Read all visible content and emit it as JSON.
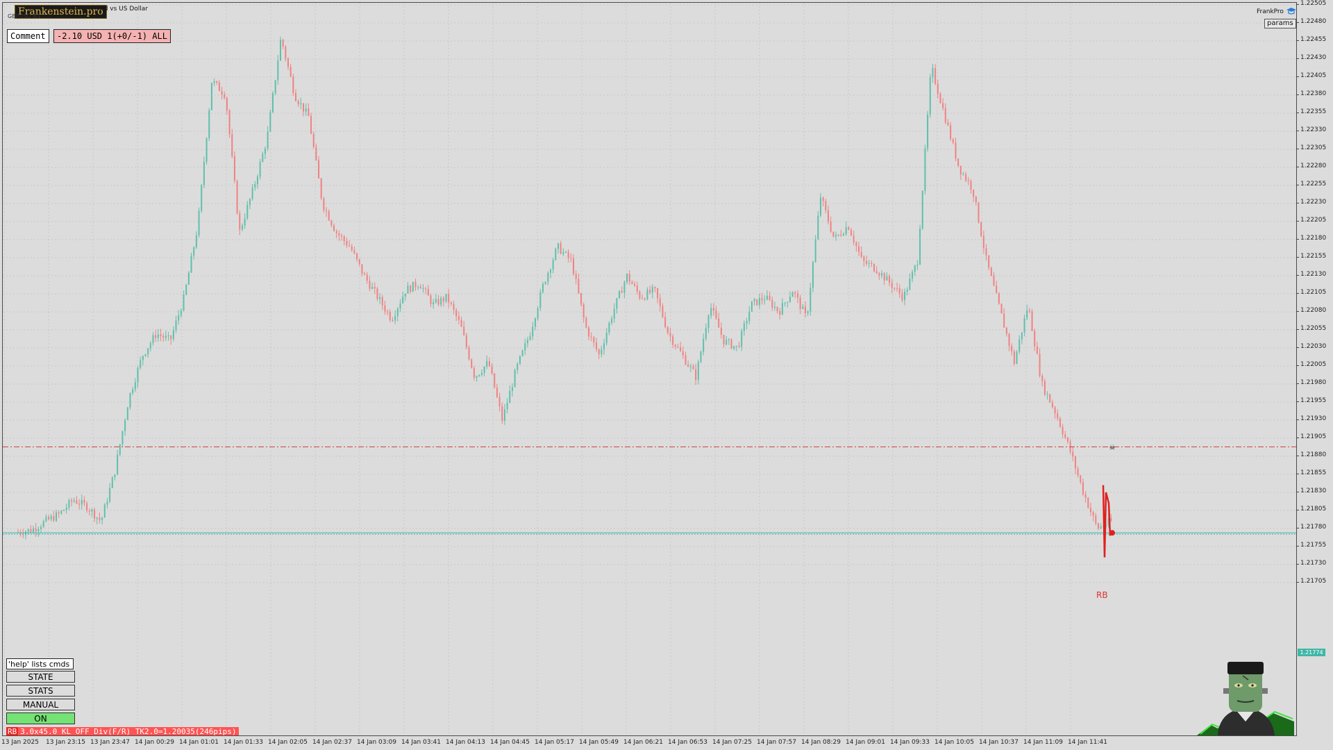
{
  "header": {
    "brand": "Frankenstein.pro",
    "symbol_title": "nd vs US Dollar",
    "symbol_sub": "GBPUSD,M1",
    "comment_label": "Comment",
    "pnl_text": "-2.10 USD 1(+0/-1) ALL",
    "frankpro_label": "FrankPro",
    "params_label": "params"
  },
  "panel": {
    "help_text": "'help' lists cmds",
    "buttons": [
      "STATE",
      "STATS",
      "MANUAL",
      "ON"
    ],
    "status_tag": "RB",
    "status_text": "3.0x45.0 KL_OFF Div(F/R) TK2.0=1.20035(246pips)"
  },
  "chart": {
    "rb_label": "RB",
    "current_price": "1.21774",
    "colors": {
      "bull": "#5fbfaa",
      "bear": "#f08282",
      "stop_line": "#d04040",
      "price_line": "#3fb7a7",
      "grid": "#c8c8c8"
    }
  },
  "icons": [
    "graduation-cap-icon",
    "skull-crossbones-icon",
    "trade-marker-icon",
    "frankenstein-mascot-icon"
  ],
  "chart_data": {
    "type": "candlestick",
    "price_axis": [
      "1.22505",
      "1.22480",
      "1.22455",
      "1.22430",
      "1.22405",
      "1.22380",
      "1.22355",
      "1.22330",
      "1.22305",
      "1.22280",
      "1.22255",
      "1.22230",
      "1.22205",
      "1.22180",
      "1.22155",
      "1.22130",
      "1.22105",
      "1.22080",
      "1.22055",
      "1.22030",
      "1.22005",
      "1.21980",
      "1.21955",
      "1.21930",
      "1.21905",
      "1.21880",
      "1.21855",
      "1.21830",
      "1.21805",
      "1.21780",
      "1.21755",
      "1.21730",
      "1.21705"
    ],
    "ylim": [
      1.21685,
      1.22515
    ],
    "time_axis": [
      "13 Jan 2025",
      "13 Jan 23:15",
      "13 Jan 23:47",
      "14 Jan 00:29",
      "14 Jan 01:01",
      "14 Jan 01:33",
      "14 Jan 02:05",
      "14 Jan 02:37",
      "14 Jan 03:09",
      "14 Jan 03:41",
      "14 Jan 04:13",
      "14 Jan 04:45",
      "14 Jan 05:17",
      "14 Jan 05:49",
      "14 Jan 06:21",
      "14 Jan 06:53",
      "14 Jan 07:25",
      "14 Jan 07:57",
      "14 Jan 08:29",
      "14 Jan 09:01",
      "14 Jan 09:33",
      "14 Jan 10:05",
      "14 Jan 10:37",
      "14 Jan 11:09",
      "14 Jan 11:41"
    ],
    "close_path": [
      [
        0,
        1.21775
      ],
      [
        1,
        1.21778
      ],
      [
        2,
        1.2179
      ],
      [
        3,
        1.218
      ],
      [
        4,
        1.2182
      ],
      [
        5,
        1.2181
      ],
      [
        6,
        1.2179
      ],
      [
        7,
        1.2186
      ],
      [
        8,
        1.2196
      ],
      [
        9,
        1.2202
      ],
      [
        10,
        1.2205
      ],
      [
        11,
        1.2204
      ],
      [
        12,
        1.221
      ],
      [
        13,
        1.222
      ],
      [
        14,
        1.224
      ],
      [
        15,
        1.2238
      ],
      [
        16,
        1.2219
      ],
      [
        17,
        1.2225
      ],
      [
        18,
        1.2232
      ],
      [
        19,
        1.2246
      ],
      [
        20,
        1.2238
      ],
      [
        21,
        1.2235
      ],
      [
        22,
        1.2223
      ],
      [
        23,
        1.2219
      ],
      [
        24,
        1.2217
      ],
      [
        25,
        1.2213
      ],
      [
        26,
        1.221
      ],
      [
        27,
        1.2207
      ],
      [
        28,
        1.2211
      ],
      [
        29,
        1.2212
      ],
      [
        30,
        1.2209
      ],
      [
        31,
        1.221
      ],
      [
        32,
        1.2206
      ],
      [
        33,
        1.2199
      ],
      [
        34,
        1.2201
      ],
      [
        35,
        1.2193
      ],
      [
        36,
        1.22
      ],
      [
        37,
        1.2205
      ],
      [
        38,
        1.2212
      ],
      [
        39,
        1.2217
      ],
      [
        40,
        1.2215
      ],
      [
        41,
        1.2206
      ],
      [
        42,
        1.2202
      ],
      [
        43,
        1.2208
      ],
      [
        44,
        1.2213
      ],
      [
        45,
        1.221
      ],
      [
        46,
        1.2211
      ],
      [
        47,
        1.2205
      ],
      [
        48,
        1.2202
      ],
      [
        49,
        1.2199
      ],
      [
        50,
        1.2209
      ],
      [
        51,
        1.2204
      ],
      [
        52,
        1.2203
      ],
      [
        53,
        1.2209
      ],
      [
        54,
        1.221
      ],
      [
        55,
        1.2208
      ],
      [
        56,
        1.2211
      ],
      [
        57,
        1.2207
      ],
      [
        58,
        1.2224
      ],
      [
        59,
        1.2218
      ],
      [
        60,
        1.222
      ],
      [
        61,
        1.2215
      ],
      [
        62,
        1.2214
      ],
      [
        63,
        1.2212
      ],
      [
        64,
        1.221
      ],
      [
        65,
        1.2215
      ],
      [
        66,
        1.2242
      ],
      [
        67,
        1.2235
      ],
      [
        68,
        1.2228
      ],
      [
        69,
        1.2225
      ],
      [
        70,
        1.2215
      ],
      [
        71,
        1.2208
      ],
      [
        72,
        1.2201
      ],
      [
        73,
        1.2209
      ],
      [
        74,
        1.2198
      ],
      [
        75,
        1.2194
      ],
      [
        76,
        1.2189
      ],
      [
        77,
        1.2183
      ],
      [
        78,
        1.2178
      ],
      [
        79,
        1.2179
      ]
    ],
    "stop_level": 1.21893,
    "current_price": 1.21774
  }
}
